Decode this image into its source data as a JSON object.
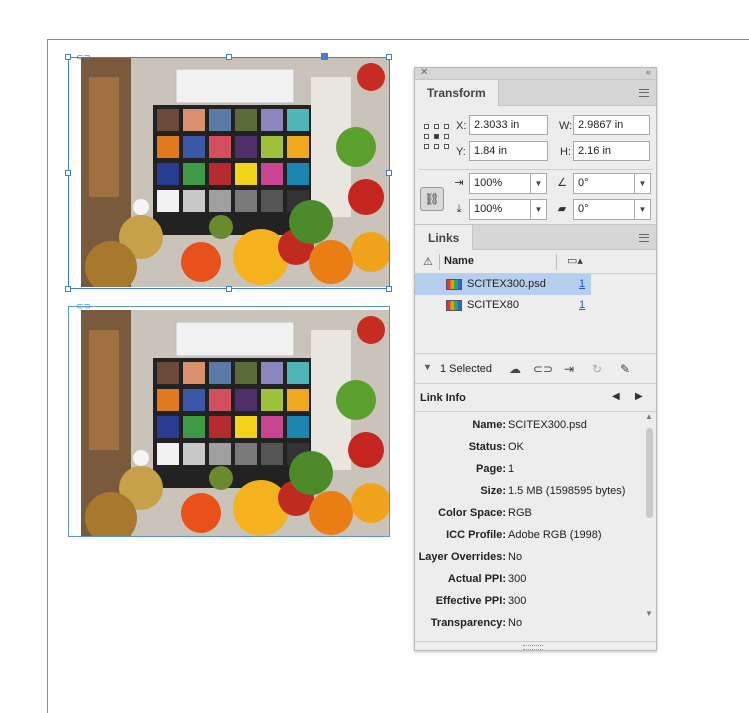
{
  "canvas": {
    "image_main_alt": "SCITEX300",
    "image_second_alt": "SCITEX80"
  },
  "transform": {
    "tab_label": "Transform",
    "x_label": "X:",
    "x_value": "2.3033 in",
    "y_label": "Y:",
    "y_value": "1.84 in",
    "w_label": "W:",
    "w_value": "2.9867 in",
    "h_label": "H:",
    "h_value": "2.16 in",
    "scale_x": "100%",
    "scale_y": "100%",
    "rotation": "0°",
    "shear": "0°"
  },
  "links": {
    "tab_label": "Links",
    "col_name": "Name",
    "rows": [
      {
        "name": "SCITEX300.psd",
        "page": "1",
        "selected": true
      },
      {
        "name": "SCITEX80",
        "page": "1",
        "selected": false
      }
    ],
    "selected_count": "1 Selected"
  },
  "link_info": {
    "title": "Link Info",
    "fields": [
      {
        "key": "Name:",
        "value": "SCITEX300.psd"
      },
      {
        "key": "Status:",
        "value": "OK"
      },
      {
        "key": "Page:",
        "value": "1"
      },
      {
        "key": "Size:",
        "value": "1.5 MB (1598595 bytes)"
      },
      {
        "key": "Color Space:",
        "value": "RGB"
      },
      {
        "key": "ICC Profile:",
        "value": "Adobe RGB (1998)"
      },
      {
        "key": "Layer Overrides:",
        "value": "No"
      },
      {
        "key": "Actual PPI:",
        "value": "300"
      },
      {
        "key": "Effective PPI:",
        "value": "300"
      },
      {
        "key": "Transparency:",
        "value": "No"
      }
    ]
  },
  "colors": {
    "margin_guide": "#d35ad3",
    "selection": "#3d7fd6",
    "row_selected": "#b6cfee"
  }
}
